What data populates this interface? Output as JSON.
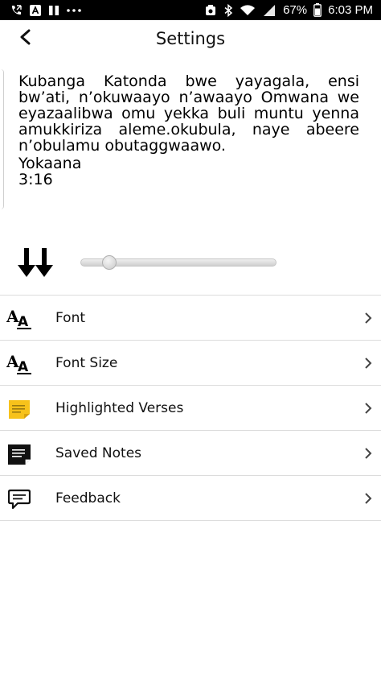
{
  "status_bar": {
    "battery": "67%",
    "time": "6:03 PM",
    "icons": [
      "call-icon",
      "notification-a-icon",
      "pause-icon",
      "more-dots-icon",
      "alarm-icon",
      "bluetooth-icon",
      "wifi-icon",
      "signal-icon",
      "battery-icon"
    ]
  },
  "header": {
    "title": "Settings",
    "back_icon": "back-arrow-icon"
  },
  "preview": {
    "verse": "Kubanga Katonda bwe yayagala, ensi bw’ati, n’okuwaayo n’awaayo Omwana we eyazaalibwa omu yekka buli muntu yenna amukkiriza aleme.okubula, naye abeere n’obulamu obutaggwaawo.",
    "reference_book": "Yokaana",
    "reference_chapter_verse": "3:16"
  },
  "scroll_speed": {
    "icon": "double-down-arrow-icon",
    "slider_fraction": 0.1
  },
  "menu": {
    "items": [
      {
        "label": "Font",
        "icon": "font-icon"
      },
      {
        "label": "Font Size",
        "icon": "font-size-icon"
      },
      {
        "label": "Highlighted Verses",
        "icon": "sticky-note-icon"
      },
      {
        "label": "Saved Notes",
        "icon": "note-icon"
      },
      {
        "label": "Feedback",
        "icon": "feedback-icon"
      }
    ]
  },
  "colors": {
    "status_bar_bg": "#000000",
    "highlight_yellow": "#F7C21B",
    "divider": "#DCDCDC"
  }
}
